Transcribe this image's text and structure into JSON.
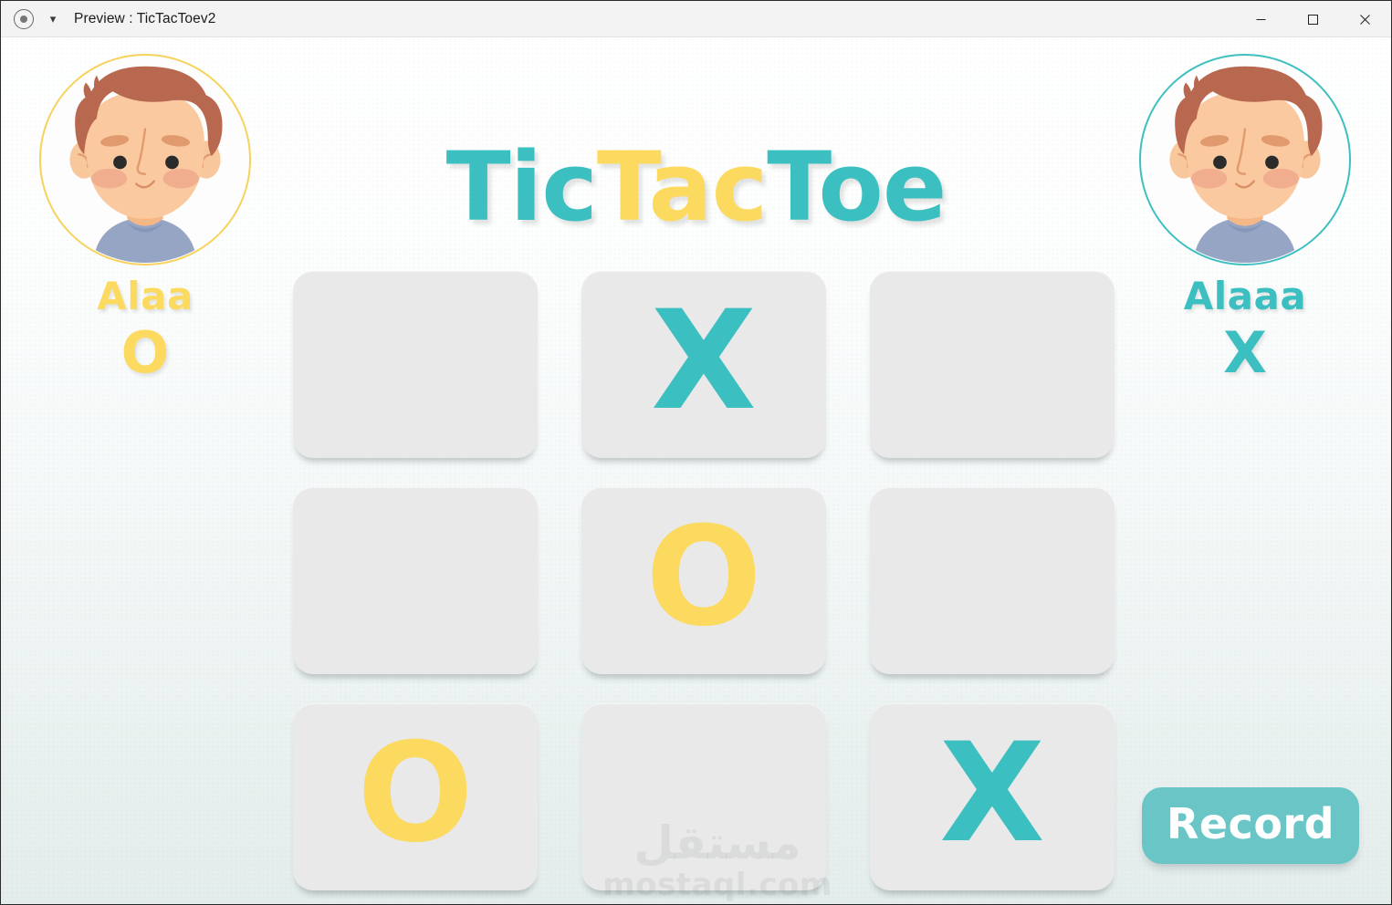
{
  "window": {
    "title": "Preview : TicTacToev2",
    "app_icon": "record-circle-icon",
    "chevron": "˅",
    "controls": {
      "minimize": "minimize-icon",
      "maximize": "maximize-icon",
      "close": "close-icon"
    }
  },
  "game": {
    "title_parts": [
      {
        "text": "Tic",
        "color": "#3cbfc0"
      },
      {
        "text": "Tac",
        "color": "#fcd95f"
      },
      {
        "text": "Toe",
        "color": "#3cbfc0"
      }
    ],
    "title_full": "TicTacToe"
  },
  "players": {
    "left": {
      "name": "Alaa",
      "mark": "O",
      "color": "#fcd95f",
      "avatar": "boy-avatar-icon"
    },
    "right": {
      "name": "Alaaa",
      "mark": "X",
      "color": "#3cbfc0",
      "avatar": "boy-avatar-icon"
    }
  },
  "board": {
    "cells": [
      {
        "row": 0,
        "col": 0,
        "mark": ""
      },
      {
        "row": 0,
        "col": 1,
        "mark": "X"
      },
      {
        "row": 0,
        "col": 2,
        "mark": ""
      },
      {
        "row": 1,
        "col": 0,
        "mark": ""
      },
      {
        "row": 1,
        "col": 1,
        "mark": "O"
      },
      {
        "row": 1,
        "col": 2,
        "mark": ""
      },
      {
        "row": 2,
        "col": 0,
        "mark": "O"
      },
      {
        "row": 2,
        "col": 1,
        "mark": ""
      },
      {
        "row": 2,
        "col": 2,
        "mark": "X"
      }
    ]
  },
  "buttons": {
    "record": "Record"
  },
  "watermark": {
    "arabic": "مستقل",
    "latin": "mostaql.com"
  },
  "colors": {
    "teal": "#3cbfc0",
    "yellow": "#fcd95f",
    "cell": "#e9e9e9",
    "record_bg": "#6ac6c6"
  }
}
